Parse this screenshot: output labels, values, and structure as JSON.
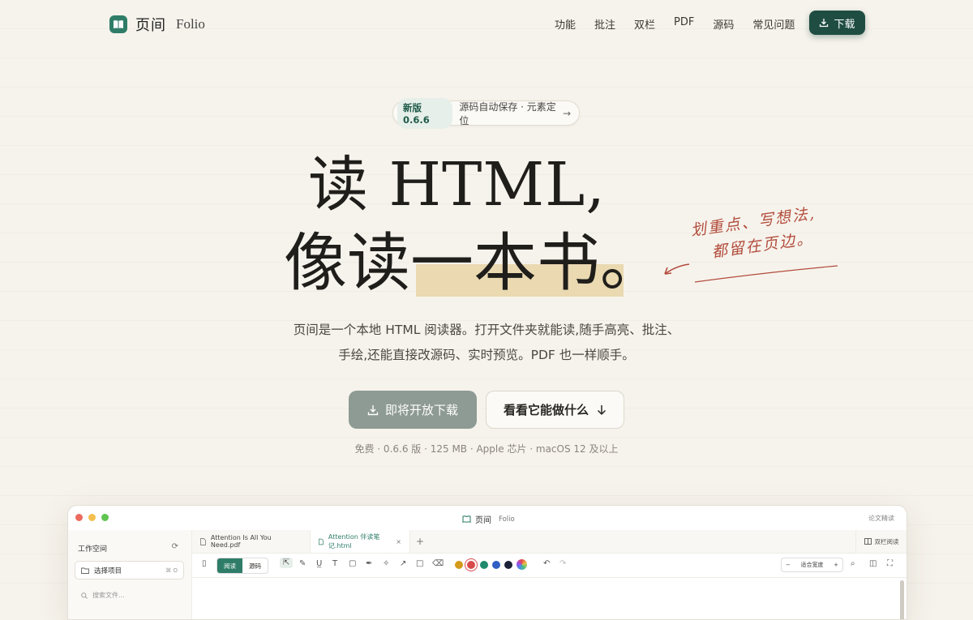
{
  "nav": {
    "brand_cn": "页间",
    "brand_en": "Folio",
    "links": [
      "功能",
      "批注",
      "双栏",
      "PDF",
      "源码",
      "常见问题"
    ],
    "download_label": "下载"
  },
  "badge": {
    "tag": "新版 0.6.6",
    "text": "源码自动保存 · 元素定位",
    "arrow": "→"
  },
  "hero": {
    "line1": "读 HTML,",
    "line2": "像读一本书。",
    "margin_note_line1": "划重点、写想法,",
    "margin_note_line2": "都留在页边。"
  },
  "subtitle": {
    "line1": "页间是一个本地 HTML 阅读器。打开文件夹就能读,随手高亮、批注、",
    "line2": "手绘,还能直接改源码、实时预览。PDF 也一样顺手。"
  },
  "cta": {
    "primary": "即将开放下载",
    "secondary": "看看它能做什么"
  },
  "meta": "免费 · 0.6.6 版 · 125 MB · Apple 芯片 · macOS 12 及以上",
  "app": {
    "title_cn": "页间",
    "title_en": "Folio",
    "right_label": "论文精读",
    "sidebar": {
      "workspace": "工作空间",
      "project": "选择项目",
      "project_kbd": "⌘ O",
      "search_placeholder": "搜索文件..."
    },
    "tabs": [
      {
        "label": "Attention Is All You Need.pdf",
        "active": false
      },
      {
        "label": "Attention 伴读笔记.html",
        "active": true
      }
    ],
    "dual_read": "双栏阅读",
    "mode_read": "阅读",
    "mode_source": "源码",
    "zoom_label": "适合宽度",
    "colors": [
      "#d49a1c",
      "#d84a4a",
      "#1f8a6c",
      "#2f5fc4",
      "#1e2238"
    ]
  }
}
